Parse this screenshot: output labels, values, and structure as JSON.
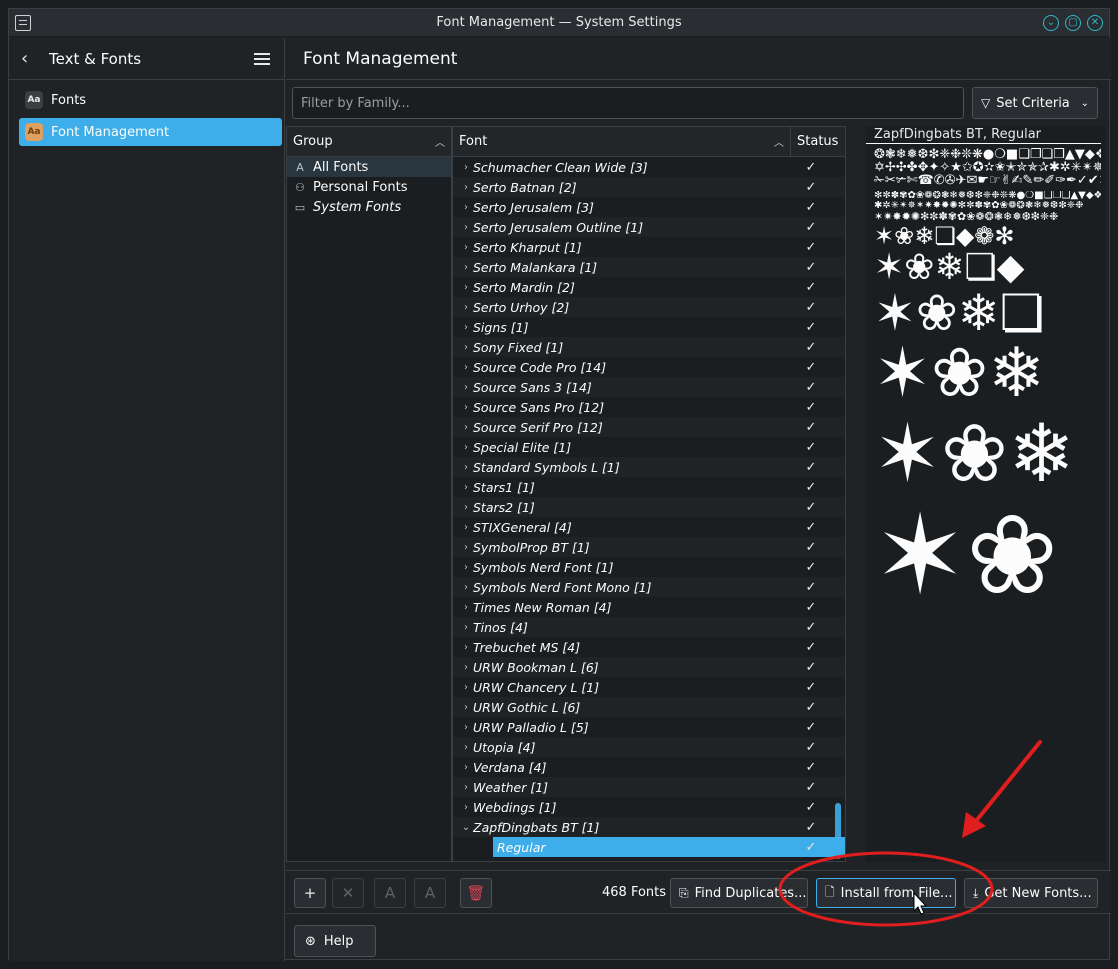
{
  "window": {
    "title": "Font Management — System Settings",
    "buttons": [
      "minimize",
      "maximize",
      "close"
    ]
  },
  "sidebar": {
    "back_label": "Text & Fonts",
    "items": [
      {
        "label": "Fonts",
        "icon": "fonts-icon",
        "active": false
      },
      {
        "label": "Font Management",
        "icon": "font-management-icon",
        "active": true
      }
    ]
  },
  "main": {
    "title": "Font Management",
    "filter": {
      "placeholder": "Filter by Family...",
      "value": ""
    },
    "criteria_label": "Set Criteria"
  },
  "groups": {
    "header": "Group",
    "items": [
      {
        "label": "All Fonts",
        "icon": "font-icon",
        "active": true
      },
      {
        "label": "Personal Fonts",
        "icon": "user-icon",
        "active": false
      },
      {
        "label": "System Fonts",
        "icon": "monitor-icon",
        "active": false
      }
    ]
  },
  "fonts": {
    "header": "Font",
    "status_header": "Status",
    "rows": [
      "Schumacher Clean Wide [3]",
      "Serto Batnan [2]",
      "Serto Jerusalem [3]",
      "Serto Jerusalem Outline [1]",
      "Serto Kharput [1]",
      "Serto Malankara [1]",
      "Serto Mardin [2]",
      "Serto Urhoy [2]",
      "Signs [1]",
      "Sony Fixed [1]",
      "Source Code Pro [14]",
      "Source Sans 3 [14]",
      "Source Sans Pro [12]",
      "Source Serif Pro [12]",
      "Special Elite [1]",
      "Standard Symbols L [1]",
      "Stars1 [1]",
      "Stars2 [1]",
      "STIXGeneral [4]",
      "SymbolProp BT [1]",
      "Symbols Nerd Font [1]",
      "Symbols Nerd Font Mono [1]",
      "Times New Roman [4]",
      "Tinos [4]",
      "Trebuchet MS [4]",
      "URW Bookman L [6]",
      "URW Chancery L [1]",
      "URW Gothic L [6]",
      "URW Palladio L [5]",
      "Utopia [4]",
      "Verdana [4]",
      "Weather [1]",
      "Webdings [1]",
      "ZapfDingbats BT [1]"
    ],
    "expanded_child": "Regular"
  },
  "preview": {
    "title": "ZapfDingbats BT, Regular"
  },
  "toolbar": {
    "font_count": "468 Fonts",
    "find_duplicates": "Find Duplicates...",
    "install_from_file": "Install from File...",
    "get_new_fonts": "Get New Fonts..."
  },
  "help_label": "Help",
  "colors": {
    "accent": "#3daee9",
    "annotation": "#e01e1e"
  }
}
